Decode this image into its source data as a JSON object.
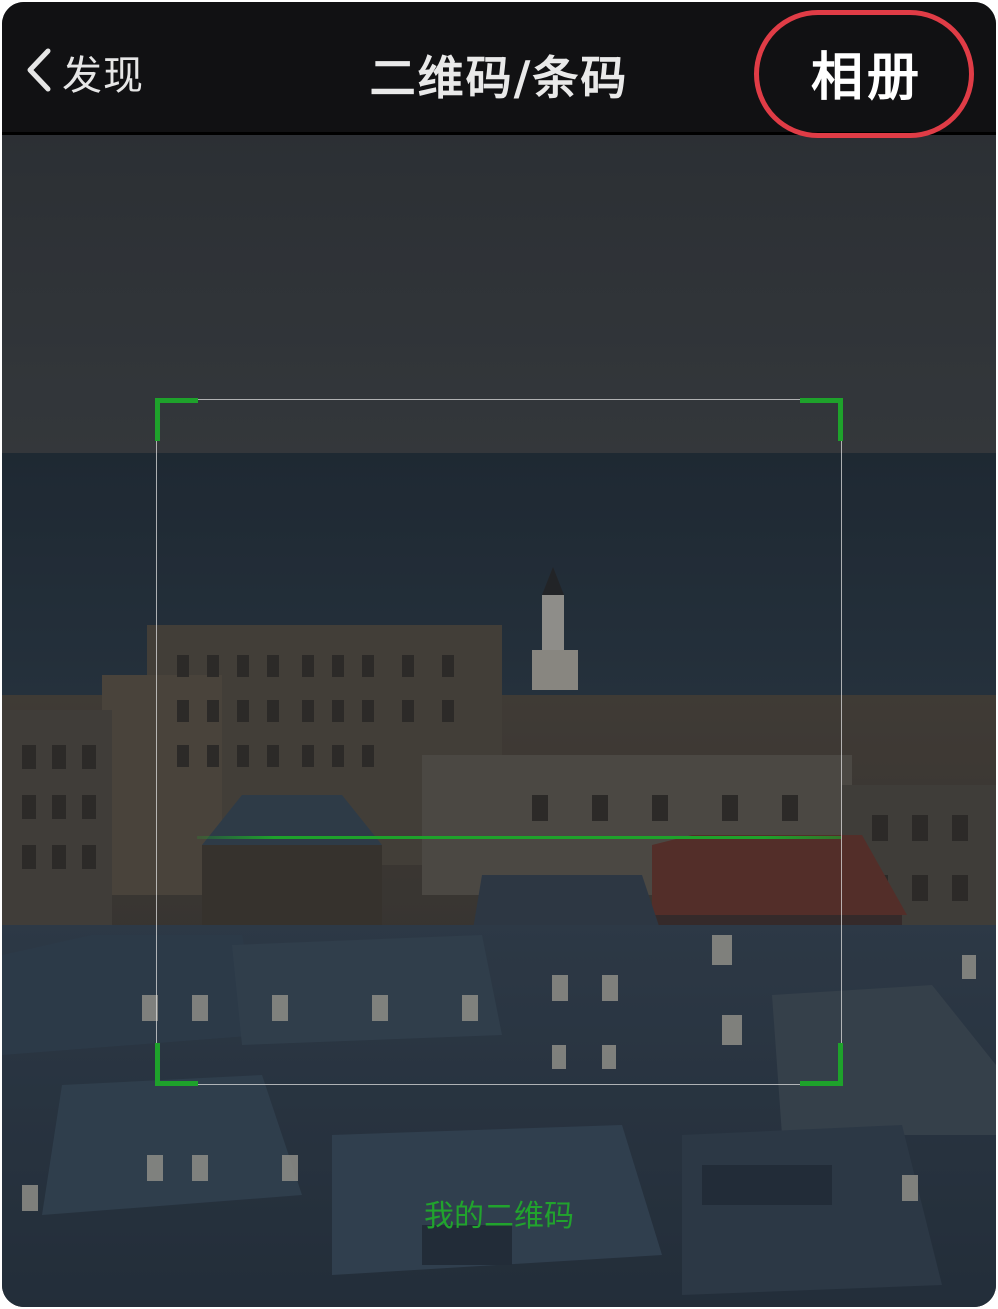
{
  "nav": {
    "back_label": "发现",
    "title": "二维码/条码",
    "album_label": "相册"
  },
  "scanner": {
    "my_qr_label": "我的二维码"
  },
  "icons": {
    "back": "chevron-left-icon"
  },
  "colors": {
    "nav_background": "#111113",
    "scan_accent": "#1ea22b",
    "highlight_ring": "#e03c46"
  }
}
